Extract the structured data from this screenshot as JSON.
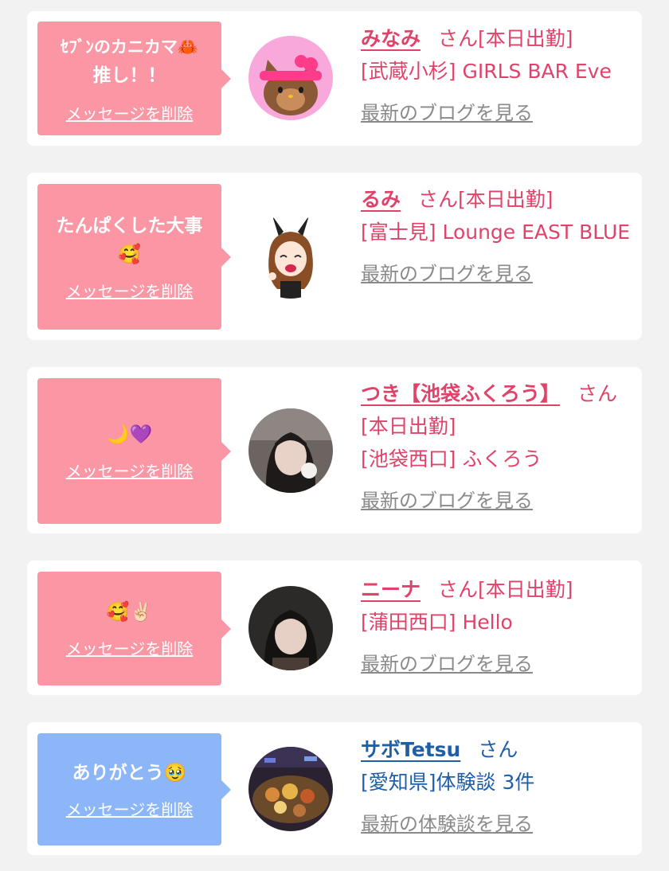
{
  "delete_label": "メッセージを削除",
  "honorific": "さん",
  "cards": [
    {
      "message_lines": [
        "ｾﾌﾞﾝのカニカマ🦀",
        "推し！！"
      ],
      "name": "みなみ",
      "status": "[本日出勤]",
      "shop": "[武蔵小杉] GIRLS BAR Eve",
      "link": "最新のブログを見る",
      "avatar": "hello-kitty-avatar",
      "bubble_color": "#fb97a4"
    },
    {
      "message_lines": [
        "たんぱくした大事",
        "🥰"
      ],
      "name": "るみ",
      "status": "[本日出勤]",
      "shop": "[富士見] Lounge EAST BLUE",
      "link": "最新のブログを見る",
      "avatar": "bunny-girl-avatar",
      "bubble_color": "#fb97a4"
    },
    {
      "message_lines": [
        "🌙💜"
      ],
      "name": "つき【池袋ふくろう】",
      "status": "[本日出勤]",
      "shop": "[池袋西口] ふくろう",
      "link": "最新のブログを見る",
      "avatar": "photo-avatar",
      "bubble_color": "#fb97a4"
    },
    {
      "message_lines": [
        "🥰✌🏻"
      ],
      "name": "ニーナ",
      "status": "[本日出勤]",
      "shop": "[蒲田西口] Hello",
      "link": "最新のブログを見る",
      "avatar": "photo-avatar",
      "bubble_color": "#fb97a4"
    },
    {
      "message_lines": [
        "ありがとう🥹"
      ],
      "name": "サボTetsu",
      "status": "",
      "shop": "[愛知県]体験談 3件",
      "link": "最新の体験談を見る",
      "avatar": "food-photo-avatar",
      "bubble_color": "#8cb6f7"
    }
  ]
}
